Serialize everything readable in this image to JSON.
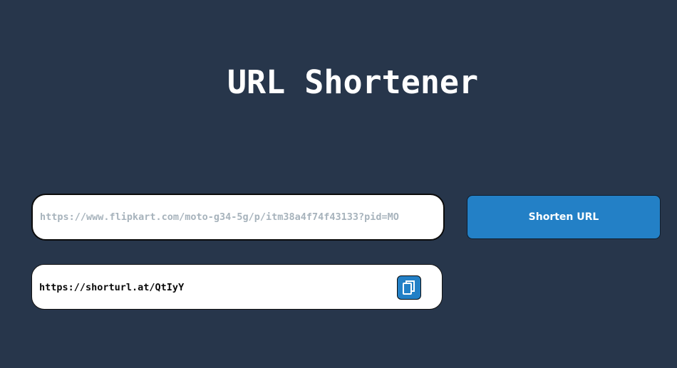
{
  "page": {
    "title": "URL Shortener"
  },
  "form": {
    "url_input_placeholder": "https://www.flipkart.com/moto-g34-5g/p/itm38a4f74f43133?pid=MO",
    "url_input_value": "",
    "shorten_button_label": "Shorten URL"
  },
  "result": {
    "short_url": "https://shorturl.at/QtIyY",
    "copy_icon": "copy-icon"
  },
  "colors": {
    "background": "#27364b",
    "accent": "#2380c6",
    "surface": "#ffffff"
  }
}
